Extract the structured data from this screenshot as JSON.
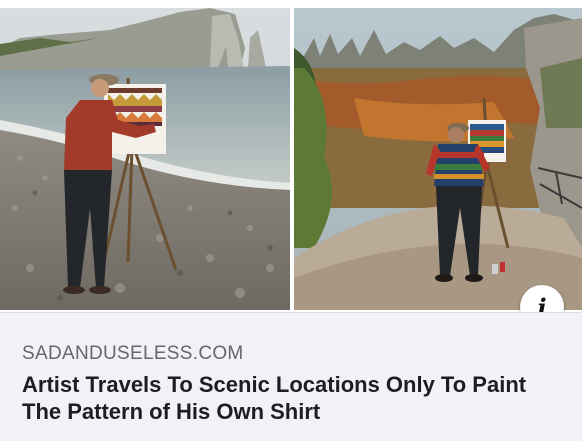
{
  "post": {
    "domain": "SADANDUSELESS.COM",
    "title": "Artist Travels To Scenic Locations Only To Paint The Pattern of His Own Shirt",
    "info_icon_glyph": "i"
  },
  "icons": {
    "info": "info-icon"
  },
  "colors": {
    "caption_background": "#f0f2f5",
    "domain_text": "#65676b",
    "title_text": "#1c1e21"
  }
}
